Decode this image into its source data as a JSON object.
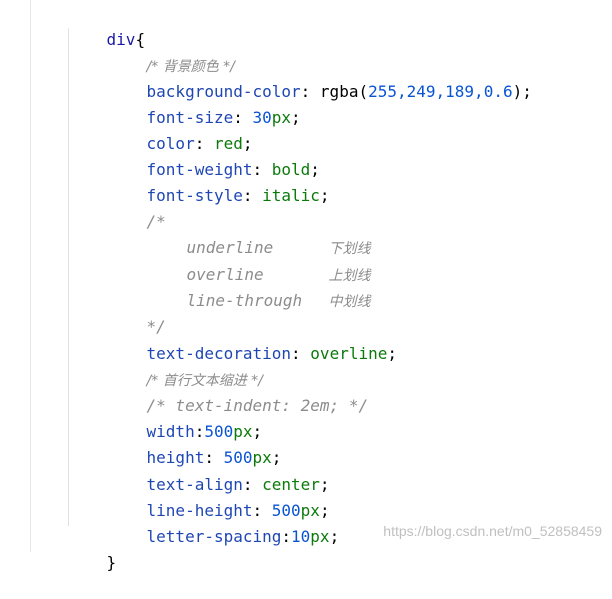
{
  "code": {
    "selector": "div",
    "open_brace": "{",
    "close_brace": "}",
    "comment_bg": "/* 背景颜色 */",
    "bg_prop": "background-color",
    "bg_fn": "rgba",
    "bg_args": "255,249,189,0.6",
    "fontsize_prop": "font-size",
    "fontsize_val": "30",
    "fontsize_unit": "px",
    "color_prop": "color",
    "color_val": "red",
    "fontweight_prop": "font-weight",
    "fontweight_val": "bold",
    "fontstyle_prop": "font-style",
    "fontstyle_val": "italic",
    "block_comment_open": "/*",
    "deco_underline": "underline",
    "deco_underline_cn": "下划线",
    "deco_overline": "overline",
    "deco_overline_cn": "上划线",
    "deco_linethrough": "line-through",
    "deco_linethrough_cn": "中划线",
    "block_comment_close": "*/",
    "textdeco_prop": "text-decoration",
    "textdeco_val": "overline",
    "comment_indent": "/* 首行文本缩进 */",
    "comment_textindent": "/* text-indent: 2em; */",
    "width_prop": "width",
    "width_val": "500",
    "width_unit": "px",
    "height_prop": "height",
    "height_val": "500",
    "height_unit": "px",
    "textalign_prop": "text-align",
    "textalign_val": "center",
    "lineheight_prop": "line-height",
    "lineheight_val": "500",
    "lineheight_unit": "px",
    "letterspacing_prop": "letter-spacing",
    "letterspacing_val": "10",
    "letterspacing_unit": "px"
  },
  "watermark": "https://blog.csdn.net/m0_52858459",
  "colors": {
    "property": "#1f47b3",
    "number": "#0a54d4",
    "value": "#0b7a0b",
    "comment": "#8c8c8c"
  }
}
